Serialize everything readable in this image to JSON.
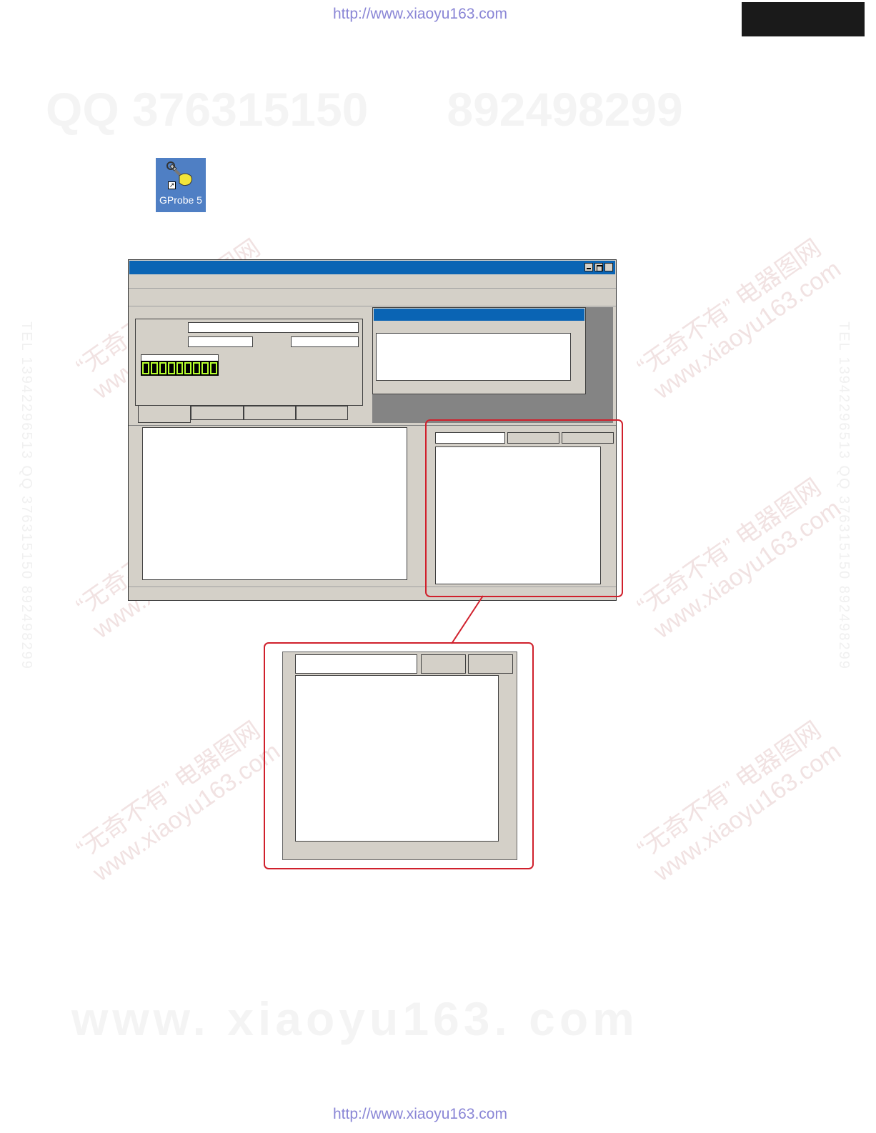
{
  "watermarks": {
    "top_url": "http://www.xiaoyu163.com",
    "bottom_url": "http://www.xiaoyu163.com",
    "qq_line": "QQ 376315150      892498299",
    "bottom_big": "www. xiaoyu163. com",
    "tel_line": "TEL 13942296513          QQ 376315150    892498299",
    "diag_cn": "“无奇不有” 电器图网",
    "diag_en": "www.xiaoyu163.com",
    "vertical": "TEL 13942296513   QQ 376315150   892498299"
  },
  "desktop_icon": {
    "label": "GProbe 5",
    "icon": "wrench-hand-icon"
  },
  "colors": {
    "titlebar": "#0a64b4",
    "window_bg": "#d4d0c8",
    "callout_border": "#d0202c",
    "led_green": "#b6ff2e"
  }
}
